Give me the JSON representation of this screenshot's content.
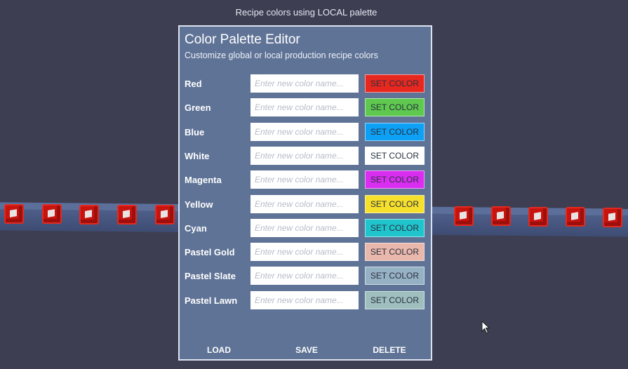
{
  "caption": "Recipe colors using LOCAL palette",
  "panel": {
    "title": "Color Palette Editor",
    "subtitle": "Customize global or local production recipe colors",
    "input_placeholder": "Enter new color name...",
    "rows": [
      {
        "label": "Red",
        "button": "SET COLOR",
        "color": "#e8271f"
      },
      {
        "label": "Green",
        "button": "SET COLOR",
        "color": "#5ec94e"
      },
      {
        "label": "Blue",
        "button": "SET COLOR",
        "color": "#0da0f4"
      },
      {
        "label": "White",
        "button": "SET COLOR",
        "color": "#ffffff"
      },
      {
        "label": "Magenta",
        "button": "SET COLOR",
        "color": "#d92ef0"
      },
      {
        "label": "Yellow",
        "button": "SET COLOR",
        "color": "#f7e02c"
      },
      {
        "label": "Cyan",
        "button": "SET COLOR",
        "color": "#20c4cc"
      },
      {
        "label": "Pastel Gold",
        "button": "SET COLOR",
        "color": "#e9b7ab"
      },
      {
        "label": "Pastel Slate",
        "button": "SET COLOR",
        "color": "#97b1c4"
      },
      {
        "label": "Pastel Lawn",
        "button": "SET COLOR",
        "color": "#9ebfbd"
      }
    ],
    "footer": {
      "load": "LOAD",
      "save": "SAVE",
      "delete": "DELETE"
    }
  },
  "colors": {
    "background": "#3d3e52",
    "panel": "#5f7396",
    "belt": "#4d5e89",
    "cube": "#c8140f"
  },
  "icons": {
    "cursor": "arrow-cursor-icon",
    "crate": "red-crate"
  }
}
